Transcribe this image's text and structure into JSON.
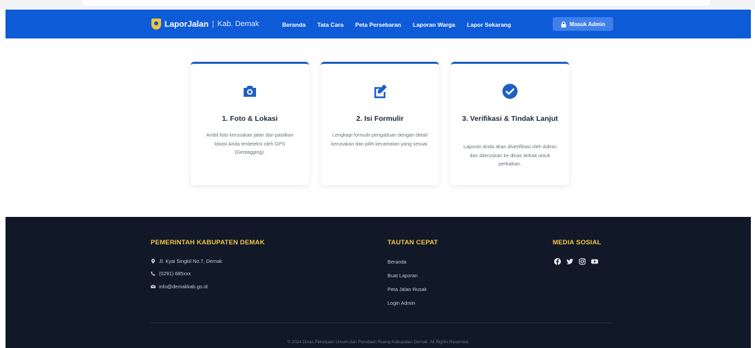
{
  "brand": {
    "name": "LaporJalan",
    "separator": "|",
    "region": "Kab. Demak"
  },
  "nav": {
    "links": [
      "Beranda",
      "Tata Cara",
      "Peta Persebaran",
      "Laporan Warga",
      "Lapor Sekarang"
    ],
    "admin_button": "Masuk Admin"
  },
  "steps": [
    {
      "icon": "camera-icon",
      "title": "1. Foto & Lokasi",
      "desc": "Ambil foto kerusakan jalan dan pastikan lokasi Anda terdeteksi oleh GPS (Geotagging)."
    },
    {
      "icon": "edit-icon",
      "title": "2. Isi Formulir",
      "desc": "Lengkapi formulir pengaduan dengan detail kerusakan dan pilih kecamatan yang sesuai."
    },
    {
      "icon": "check-circle-icon",
      "title": "3. Verifikasi & Tindak Lanjut",
      "desc": "Laporan Anda akan diverifikasi oleh Admin dan diteruskan ke dinas terkait untuk perbaikan."
    }
  ],
  "footer": {
    "gov_heading": "PEMERINTAH KABUPATEN DEMAK",
    "address": "Jl. Kyai Singkil No.7, Demak",
    "phone": "(0291) 685xxx",
    "email": "info@demakkab.go.id",
    "links_heading": "TAUTAN CEPAT",
    "links": [
      "Beranda",
      "Buat Laporan",
      "Peta Jalan Rusak",
      "Login Admin"
    ],
    "social_heading": "MEDIA SOSIAL",
    "social_icons": [
      "facebook-icon",
      "twitter-icon",
      "instagram-icon",
      "youtube-icon"
    ],
    "copyright": "© 2024 Dinas Pekerjaan Umum dan Penataan Ruang Kabupaten Demak. All Rights Reserved."
  },
  "colors": {
    "nav_bg": "#0d5bd7",
    "accent": "#1f5fc2",
    "footer_bg": "#111827",
    "footer_heading": "#f5c542"
  }
}
